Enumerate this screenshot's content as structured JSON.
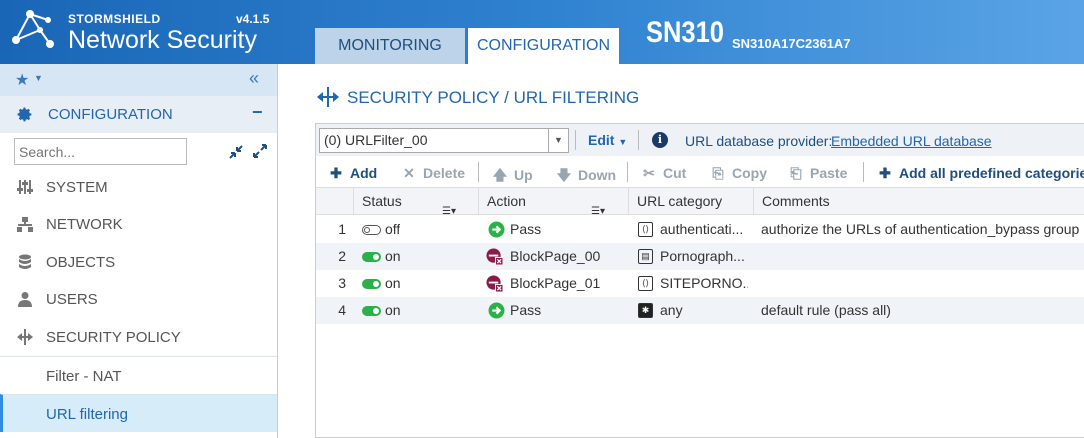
{
  "header": {
    "brand": "STORMSHIELD",
    "product": "Network Security",
    "version": "v4.1.5",
    "tabs": [
      {
        "label": "MONITORING",
        "active": false
      },
      {
        "label": "CONFIGURATION",
        "active": true
      }
    ],
    "appliance_name": "SN310",
    "appliance_serial": "SN310A17C2361A7"
  },
  "sidebar": {
    "section_label": "CONFIGURATION",
    "search_placeholder": "Search...",
    "items": [
      {
        "label": "SYSTEM",
        "icon": "sliders-icon"
      },
      {
        "label": "NETWORK",
        "icon": "network-icon"
      },
      {
        "label": "OBJECTS",
        "icon": "database-icon"
      },
      {
        "label": "USERS",
        "icon": "user-icon"
      },
      {
        "label": "SECURITY POLICY",
        "icon": "policy-arrows-icon"
      }
    ],
    "subitems": [
      {
        "label": "Filter - NAT",
        "active": false
      },
      {
        "label": "URL filtering",
        "active": true
      }
    ]
  },
  "main": {
    "title": "SECURITY POLICY / URL FILTERING",
    "policy_selected": "(0) URLFilter_00",
    "edit_label": "Edit",
    "provider_label": "URL database provider:",
    "provider_link": "Embedded URL database",
    "toolbar": {
      "add": "Add",
      "delete": "Delete",
      "up": "Up",
      "down": "Down",
      "cut": "Cut",
      "copy": "Copy",
      "paste": "Paste",
      "add_predefined": "Add all predefined categories"
    },
    "columns": [
      "Status",
      "Action",
      "URL category",
      "Comments"
    ],
    "rows": [
      {
        "num": "1",
        "status": "off",
        "action": "Pass",
        "action_type": "pass",
        "category": "authenticati...",
        "comment": "authorize the URLs of authentication_bypass group"
      },
      {
        "num": "2",
        "status": "on",
        "action": "BlockPage_00",
        "action_type": "block",
        "category": "Pornograph...",
        "comment": ""
      },
      {
        "num": "3",
        "status": "on",
        "action": "BlockPage_01",
        "action_type": "block",
        "category": "SITEPORNO...",
        "comment": ""
      },
      {
        "num": "4",
        "status": "on",
        "action": "Pass",
        "action_type": "pass",
        "category": "any",
        "comment": "default rule (pass all)"
      }
    ]
  },
  "colors": {
    "accent": "#2166b0",
    "status_on": "#2bb14a",
    "pass": "#2bb14a",
    "block": "#8a1a4a"
  }
}
